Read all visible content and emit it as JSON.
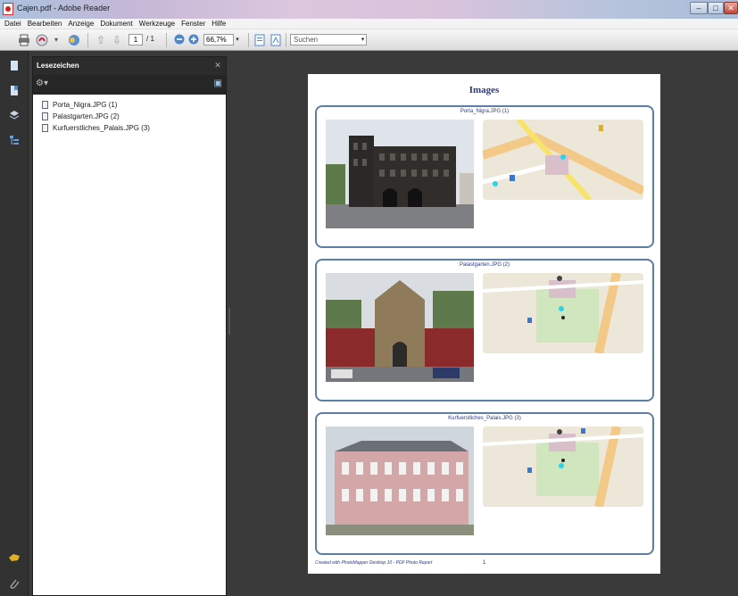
{
  "window": {
    "title": "Cajen.pdf - Adobe Reader",
    "minimize": "–",
    "maximize": "□",
    "close": "✕"
  },
  "menu": [
    "Datei",
    "Bearbeiten",
    "Anzeige",
    "Dokument",
    "Werkzeuge",
    "Fenster",
    "Hilfe"
  ],
  "toolbar": {
    "page_current": "1",
    "page_total": "/ 1",
    "zoom": "66,7%",
    "search_placeholder": "Suchen"
  },
  "icons": {
    "print": "print-icon",
    "create": "create-pdf-icon",
    "collaborate": "collaborate-icon",
    "prev": "arrow-up-icon",
    "next": "arrow-down-icon",
    "zoom_out": "zoom-out-icon",
    "zoom_in": "zoom-in-icon",
    "fit": "fit-page-icon",
    "read": "read-mode-icon"
  },
  "sidebar": {
    "title": "Lesezeichen",
    "items": [
      {
        "label": "Porta_Nigra.JPG (1)"
      },
      {
        "label": "Palastgarten.JPG (2)"
      },
      {
        "label": "Kurfuerstliches_Palais.JPG (3)"
      }
    ]
  },
  "document": {
    "title": "Images",
    "cards": [
      {
        "title": "Porta_Nigra.JPG (1)"
      },
      {
        "title": "Palastgarten.JPG (2)"
      },
      {
        "title": "Kurfuerstliches_Palais.JPG (3)"
      }
    ],
    "footer": "Created with PhotoMapper Desktop 10 - PDF Photo Report",
    "page_number": "1"
  },
  "colors": {
    "accent": "#2a3a8a",
    "card_border": "#5e7ea3",
    "viewer_bg": "#3a3a3a"
  }
}
